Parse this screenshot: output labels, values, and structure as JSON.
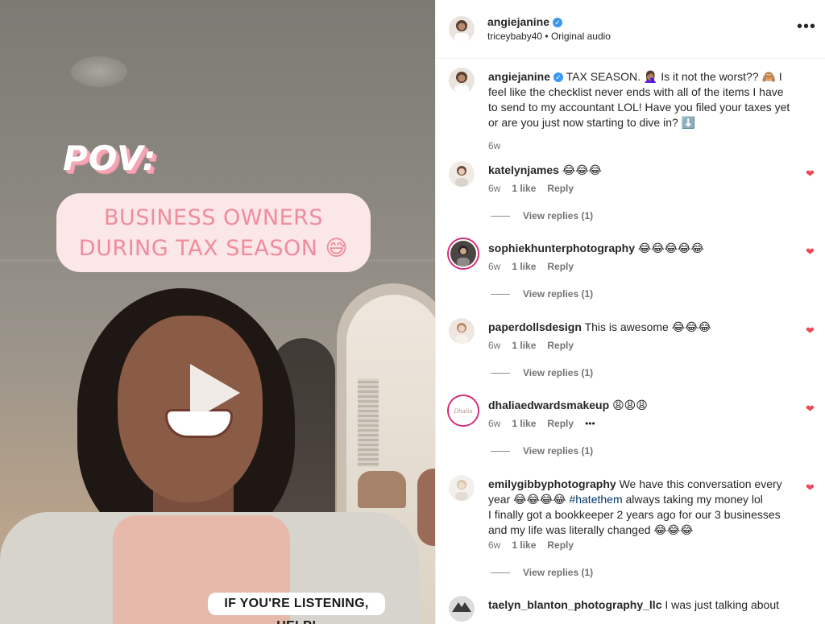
{
  "video": {
    "pov_text": "POV:",
    "banner_line1": "BUSINESS OWNERS",
    "banner_line2": "DURING TAX SEASON 😅",
    "bottom_caption": "IF YOU'RE LISTENING, HELP!",
    "play_icon": "play-icon"
  },
  "post": {
    "author": "angiejanine",
    "audio_author": "triceybaby40",
    "audio_separator": "•",
    "audio_label": "Original audio",
    "more_icon": "•••"
  },
  "caption": {
    "username": "angiejanine",
    "text": "TAX SEASON. 🤦🏽‍♀️ Is it not the worst?? 🙈 I feel like the checklist never ends with all of the items I have to send to my accountant LOL! Have you filed your taxes yet or are you just now starting to dive in? ⬇️",
    "time": "6w"
  },
  "comments": [
    {
      "username": "katelynjames",
      "text": "😂😂😂",
      "time": "6w",
      "likes": "1 like",
      "reply": "Reply",
      "view_replies": "View replies (1)"
    },
    {
      "username": "sophiekhunterphotography",
      "text": "😂😂😂😂😂",
      "time": "6w",
      "likes": "1 like",
      "reply": "Reply",
      "view_replies": "View replies (1)"
    },
    {
      "username": "paperdollsdesign",
      "text": "This is awesome 😂😂😂",
      "time": "6w",
      "likes": "1 like",
      "reply": "Reply",
      "view_replies": "View replies (1)"
    },
    {
      "username": "dhaliaedwardsmakeup",
      "text": "😩😩😩",
      "time": "6w",
      "likes": "1 like",
      "reply": "Reply",
      "more": "•••",
      "view_replies": "View replies (1)"
    },
    {
      "username": "emilygibbyphotography",
      "text_before": "We have this conversation every year 😂😂😂😂 ",
      "hashtag": "#hatethem",
      "text_after": " always taking my money lol",
      "text_line2": "I finally got a bookkeeper 2 years ago for our 3 businesses and my life was literally changed 😂😂😂",
      "time": "6w",
      "likes": "1 like",
      "reply": "Reply",
      "view_replies": "View replies (1)"
    },
    {
      "username": "taelyn_blanton_photography_llc",
      "text": "I was just talking about"
    }
  ],
  "colors": {
    "heart": "#ed4956",
    "verified": "#3897f0",
    "banner_bg": "#fbe6e8",
    "banner_text": "#ef8d9c"
  }
}
